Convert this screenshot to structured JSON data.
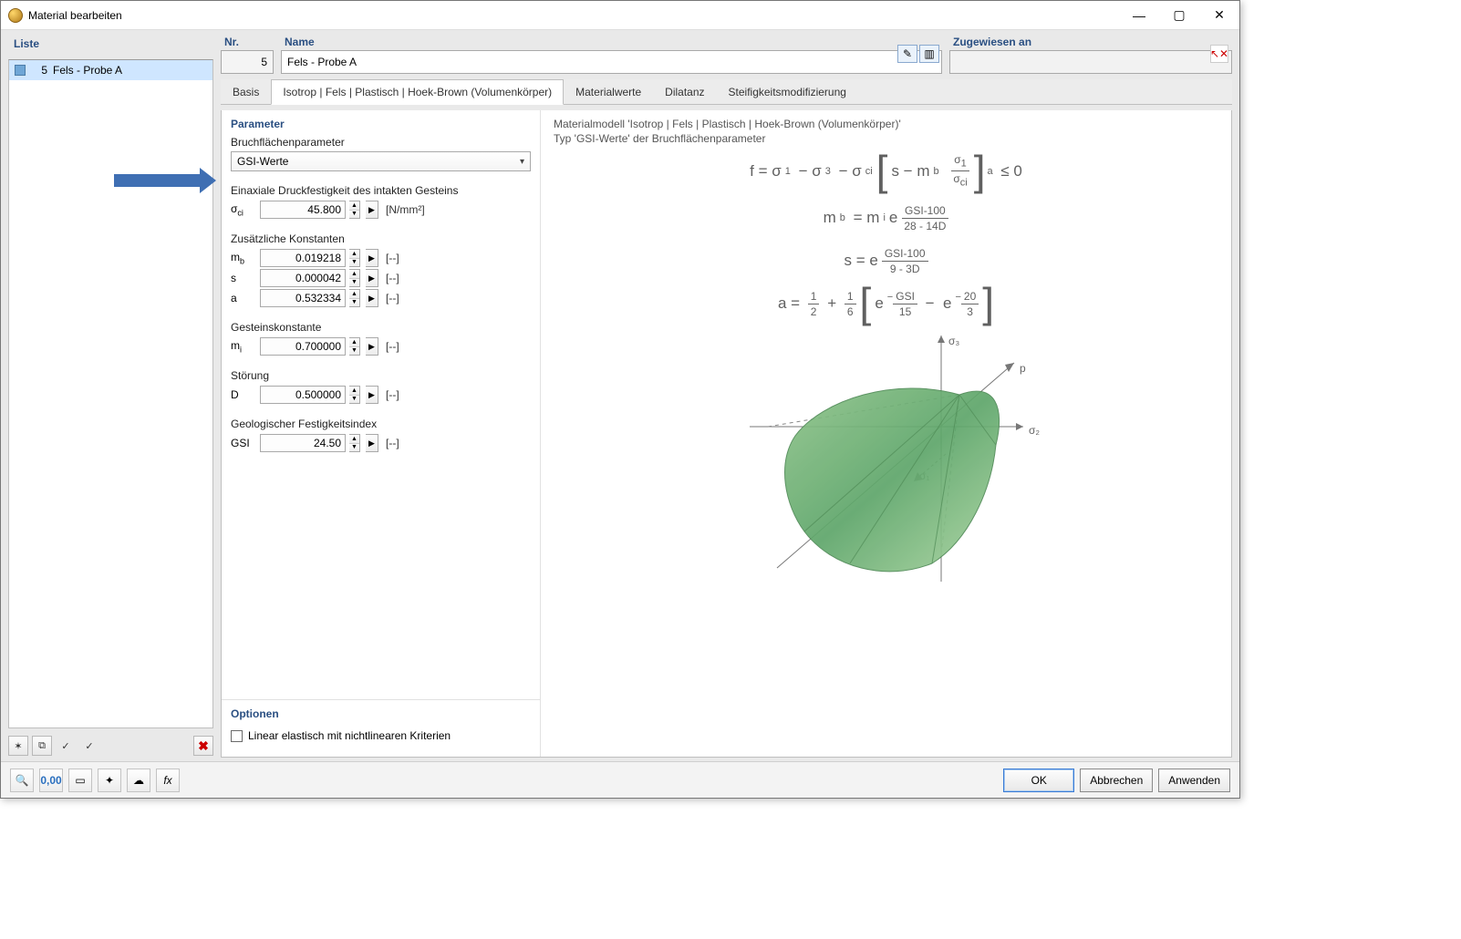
{
  "window": {
    "title": "Material bearbeiten"
  },
  "list": {
    "header": "Liste",
    "items": [
      {
        "num": "5",
        "name": "Fels - Probe A"
      }
    ]
  },
  "header": {
    "nr_label": "Nr.",
    "nr_value": "5",
    "name_label": "Name",
    "name_value": "Fels - Probe A",
    "assigned_label": "Zugewiesen an",
    "assigned_value": ""
  },
  "tabs": [
    "Basis",
    "Isotrop | Fels | Plastisch | Hoek-Brown (Volumenkörper)",
    "Materialwerte",
    "Dilatanz",
    "Steifigkeitsmodifizierung"
  ],
  "active_tab_index": 1,
  "parameters": {
    "section_title": "Parameter",
    "failure_surface_label": "Bruchflächenparameter",
    "failure_surface_value": "GSI-Werte",
    "uniaxial": {
      "label": "Einaxiale Druckfestigkeit des intakten Gesteins",
      "symbol_html": "σ<sub>ci</sub>",
      "value": "45.800",
      "unit": "[N/mm²]"
    },
    "additional_constants_label": "Zusätzliche Konstanten",
    "mb": {
      "symbol_html": "m<sub>b</sub>",
      "value": "0.019218",
      "unit": "[--]"
    },
    "s": {
      "symbol_html": "s",
      "value": "0.000042",
      "unit": "[--]"
    },
    "a": {
      "symbol_html": "a",
      "value": "0.532334",
      "unit": "[--]"
    },
    "rock_constant_label": "Gesteinskonstante",
    "mi": {
      "symbol_html": "m<sub>i</sub>",
      "value": "0.700000",
      "unit": "[--]"
    },
    "disturbance_label": "Störung",
    "D": {
      "symbol_html": "D",
      "value": "0.500000",
      "unit": "[--]"
    },
    "gsi_label": "Geologischer Festigkeitsindex",
    "gsi": {
      "symbol_html": "GSI",
      "value": "24.50",
      "unit": "[--]"
    }
  },
  "options": {
    "section_title": "Optionen",
    "linear_elastic": "Linear elastisch mit nichtlinearen Kriterien"
  },
  "info": {
    "line1": "Materialmodell 'Isotrop | Fels | Plastisch | Hoek-Brown (Volumenkörper)'",
    "line2": "Typ 'GSI-Werte' der Bruchflächenparameter"
  },
  "buttons": {
    "ok": "OK",
    "cancel": "Abbrechen",
    "apply": "Anwenden"
  }
}
